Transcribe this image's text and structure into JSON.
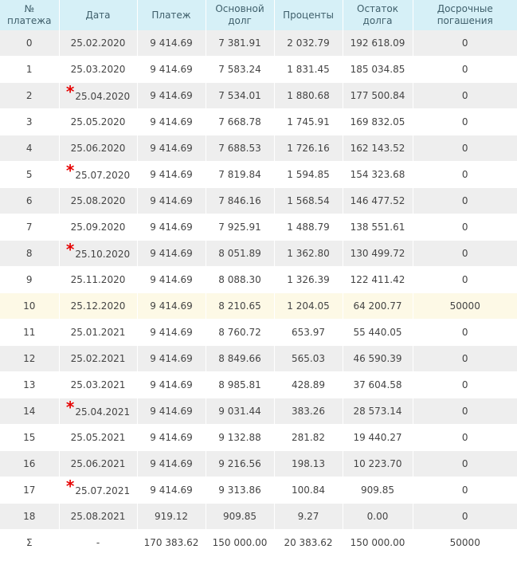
{
  "table": {
    "headers": [
      [
        "№",
        "платежа"
      ],
      [
        "Дата"
      ],
      [
        "Платеж"
      ],
      [
        "Основной",
        "долг"
      ],
      [
        "Проценты"
      ],
      [
        "Остаток",
        "долга"
      ],
      [
        "Досрочные",
        "погашения"
      ]
    ],
    "marker_symbol": "*",
    "rows": [
      {
        "n": "0",
        "date": "25.02.2020",
        "marked": false,
        "payment": "9 414.69",
        "principal": "7 381.91",
        "interest": "2 032.79",
        "balance": "192 618.09",
        "early": "0"
      },
      {
        "n": "1",
        "date": "25.03.2020",
        "marked": false,
        "payment": "9 414.69",
        "principal": "7 583.24",
        "interest": "1 831.45",
        "balance": "185 034.85",
        "early": "0"
      },
      {
        "n": "2",
        "date": "25.04.2020",
        "marked": true,
        "payment": "9 414.69",
        "principal": "7 534.01",
        "interest": "1 880.68",
        "balance": "177 500.84",
        "early": "0"
      },
      {
        "n": "3",
        "date": "25.05.2020",
        "marked": false,
        "payment": "9 414.69",
        "principal": "7 668.78",
        "interest": "1 745.91",
        "balance": "169 832.05",
        "early": "0"
      },
      {
        "n": "4",
        "date": "25.06.2020",
        "marked": false,
        "payment": "9 414.69",
        "principal": "7 688.53",
        "interest": "1 726.16",
        "balance": "162 143.52",
        "early": "0"
      },
      {
        "n": "5",
        "date": "25.07.2020",
        "marked": true,
        "payment": "9 414.69",
        "principal": "7 819.84",
        "interest": "1 594.85",
        "balance": "154 323.68",
        "early": "0"
      },
      {
        "n": "6",
        "date": "25.08.2020",
        "marked": false,
        "payment": "9 414.69",
        "principal": "7 846.16",
        "interest": "1 568.54",
        "balance": "146 477.52",
        "early": "0"
      },
      {
        "n": "7",
        "date": "25.09.2020",
        "marked": false,
        "payment": "9 414.69",
        "principal": "7 925.91",
        "interest": "1 488.79",
        "balance": "138 551.61",
        "early": "0"
      },
      {
        "n": "8",
        "date": "25.10.2020",
        "marked": true,
        "payment": "9 414.69",
        "principal": "8 051.89",
        "interest": "1 362.80",
        "balance": "130 499.72",
        "early": "0"
      },
      {
        "n": "9",
        "date": "25.11.2020",
        "marked": false,
        "payment": "9 414.69",
        "principal": "8 088.30",
        "interest": "1 326.39",
        "balance": "122 411.42",
        "early": "0"
      },
      {
        "n": "10",
        "date": "25.12.2020",
        "marked": false,
        "highlight": true,
        "payment": "9 414.69",
        "principal": "8 210.65",
        "interest": "1 204.05",
        "balance": "64 200.77",
        "early": "50000"
      },
      {
        "n": "11",
        "date": "25.01.2021",
        "marked": false,
        "payment": "9 414.69",
        "principal": "8 760.72",
        "interest": "653.97",
        "balance": "55 440.05",
        "early": "0"
      },
      {
        "n": "12",
        "date": "25.02.2021",
        "marked": false,
        "payment": "9 414.69",
        "principal": "8 849.66",
        "interest": "565.03",
        "balance": "46 590.39",
        "early": "0"
      },
      {
        "n": "13",
        "date": "25.03.2021",
        "marked": false,
        "payment": "9 414.69",
        "principal": "8 985.81",
        "interest": "428.89",
        "balance": "37 604.58",
        "early": "0"
      },
      {
        "n": "14",
        "date": "25.04.2021",
        "marked": true,
        "payment": "9 414.69",
        "principal": "9 031.44",
        "interest": "383.26",
        "balance": "28 573.14",
        "early": "0"
      },
      {
        "n": "15",
        "date": "25.05.2021",
        "marked": false,
        "payment": "9 414.69",
        "principal": "9 132.88",
        "interest": "281.82",
        "balance": "19 440.27",
        "early": "0"
      },
      {
        "n": "16",
        "date": "25.06.2021",
        "marked": false,
        "payment": "9 414.69",
        "principal": "9 216.56",
        "interest": "198.13",
        "balance": "10 223.70",
        "early": "0"
      },
      {
        "n": "17",
        "date": "25.07.2021",
        "marked": true,
        "payment": "9 414.69",
        "principal": "9 313.86",
        "interest": "100.84",
        "balance": "909.85",
        "early": "0"
      },
      {
        "n": "18",
        "date": "25.08.2021",
        "marked": false,
        "payment": "919.12",
        "principal": "909.85",
        "interest": "9.27",
        "balance": "0.00",
        "early": "0"
      },
      {
        "n": "Σ",
        "date": "-",
        "marked": false,
        "payment": "170 383.62",
        "principal": "150 000.00",
        "interest": "20 383.62",
        "balance": "150 000.00",
        "early": "50000"
      }
    ]
  },
  "colors": {
    "header_bg": "#d6f0f7",
    "row_alt_bg": "#eeeeee",
    "highlight_bg": "#fdf9e6",
    "marker": "#e60000"
  }
}
